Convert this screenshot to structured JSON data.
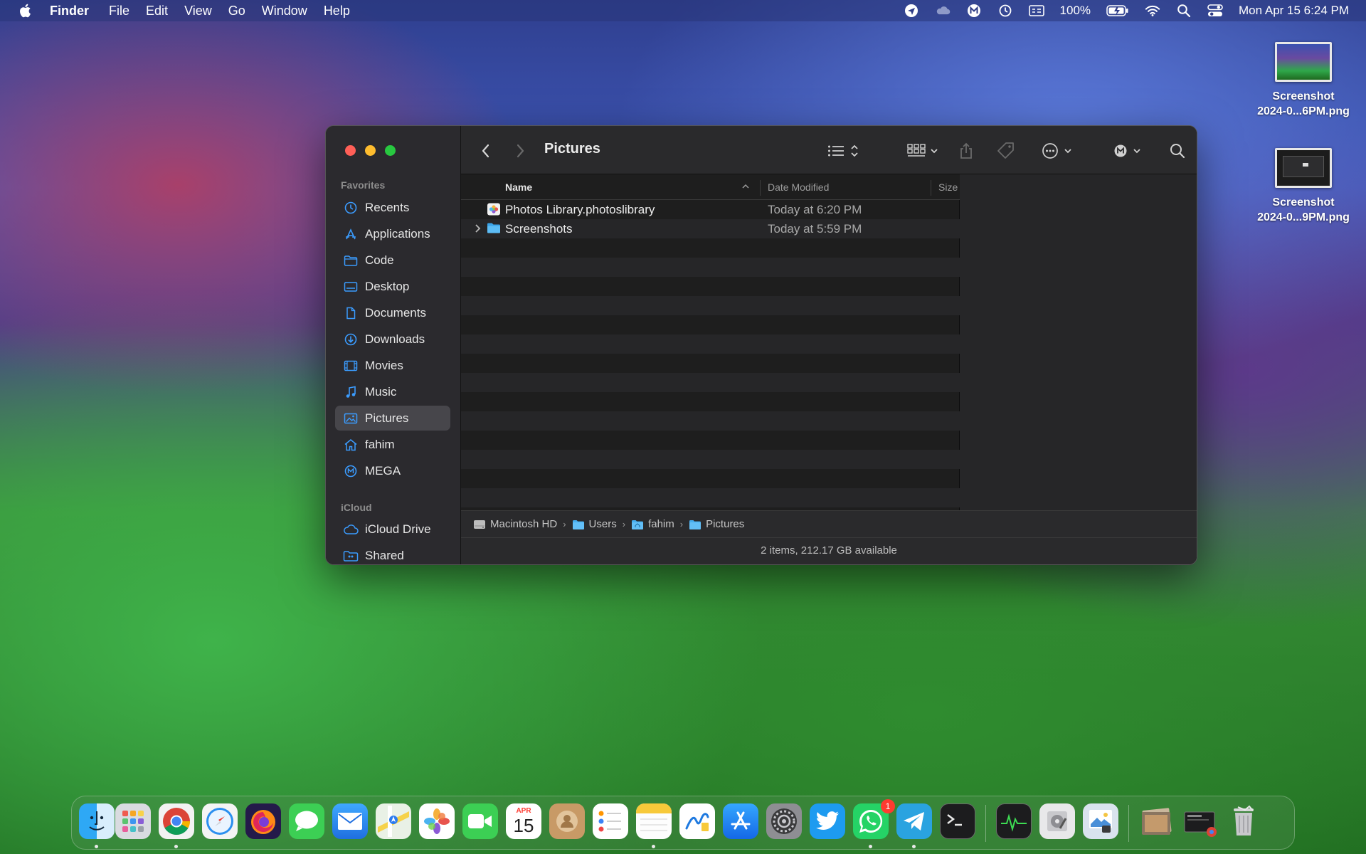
{
  "menubar": {
    "app_name": "Finder",
    "menus": [
      "File",
      "Edit",
      "View",
      "Go",
      "Window",
      "Help"
    ],
    "battery": "100%",
    "clock": "Mon Apr 15  6:24 PM",
    "status_icons": [
      "location-icon",
      "cloud-icon",
      "mega-icon",
      "time-machine-icon",
      "keyboard-input-icon",
      "battery-icon",
      "wifi-icon",
      "spotlight-icon",
      "control-center-icon"
    ]
  },
  "desktop": {
    "files": [
      {
        "line1": "Screenshot",
        "line2": "2024-0...6PM.png"
      },
      {
        "line1": "Screenshot",
        "line2": "2024-0...9PM.png"
      }
    ]
  },
  "window": {
    "title": "Pictures",
    "sidebar": {
      "favorites_label": "Favorites",
      "favorites": [
        {
          "label": "Recents",
          "icon": "clock-icon"
        },
        {
          "label": "Applications",
          "icon": "applications-icon"
        },
        {
          "label": "Code",
          "icon": "folder-icon"
        },
        {
          "label": "Desktop",
          "icon": "desktop-icon"
        },
        {
          "label": "Documents",
          "icon": "document-icon"
        },
        {
          "label": "Downloads",
          "icon": "download-icon"
        },
        {
          "label": "Movies",
          "icon": "film-icon"
        },
        {
          "label": "Music",
          "icon": "music-note-icon"
        },
        {
          "label": "Pictures",
          "icon": "photo-icon",
          "selected": true
        },
        {
          "label": "fahim",
          "icon": "home-icon"
        },
        {
          "label": "MEGA",
          "icon": "mega-icon"
        }
      ],
      "icloud_label": "iCloud",
      "icloud": [
        {
          "label": "iCloud Drive",
          "icon": "cloud-icon"
        },
        {
          "label": "Shared",
          "icon": "shared-folder-icon"
        }
      ]
    },
    "columns": {
      "name": "Name",
      "date_modified": "Date Modified",
      "size": "Size"
    },
    "files": [
      {
        "name": "Photos Library.photoslibrary",
        "date": "Today at 6:20 PM",
        "icon": "photos-library-icon",
        "expandable": false
      },
      {
        "name": "Screenshots",
        "date": "Today at 5:59 PM",
        "icon": "folder-icon",
        "expandable": true
      }
    ],
    "path": [
      "Macintosh HD",
      "Users",
      "fahim",
      "Pictures"
    ],
    "status": "2 items, 212.17 GB available"
  },
  "dock": {
    "apps": [
      "Finder",
      "Launchpad",
      "Chrome",
      "Safari",
      "Firefox",
      "Messages",
      "Mail",
      "Maps",
      "Photos",
      "FaceTime",
      "Calendar",
      "Contacts",
      "Reminders",
      "Notes",
      "Freeform",
      "App Store",
      "System Settings",
      "Twitter",
      "WhatsApp",
      "Telegram",
      "Terminal",
      "Activity Monitor",
      "Disk Utility",
      "Preview",
      "Downloads Stack",
      "Screenshots Stack",
      "Trash"
    ],
    "calendar_month": "APR",
    "calendar_day": "15",
    "whatsapp_badge": "1"
  }
}
